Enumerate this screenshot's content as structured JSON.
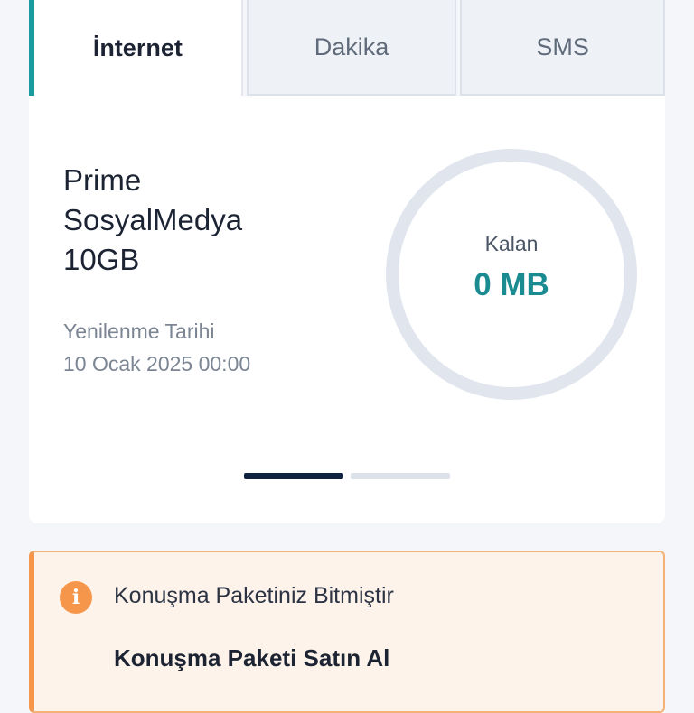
{
  "tabs": [
    {
      "label": "İnternet",
      "active": true
    },
    {
      "label": "Dakika",
      "active": false
    },
    {
      "label": "SMS",
      "active": false
    }
  ],
  "package": {
    "name": "Prime SosyalMedya 10GB",
    "renewal_label": "Yenilenme Tarihi",
    "renewal_date": "10 Ocak 2025 00:00"
  },
  "gauge": {
    "label": "Kalan",
    "value": "0 MB",
    "remaining_fraction": 0,
    "track_color": "#e1e6ee",
    "accent_color": "#1a8c91"
  },
  "pager": {
    "pages": 2,
    "active_index": 0
  },
  "alert": {
    "icon": "info-icon",
    "message": "Konuşma Paketiniz Bitmiştir",
    "action_label": "Konuşma Paketi Satın Al",
    "accent_color": "#f5964a"
  }
}
